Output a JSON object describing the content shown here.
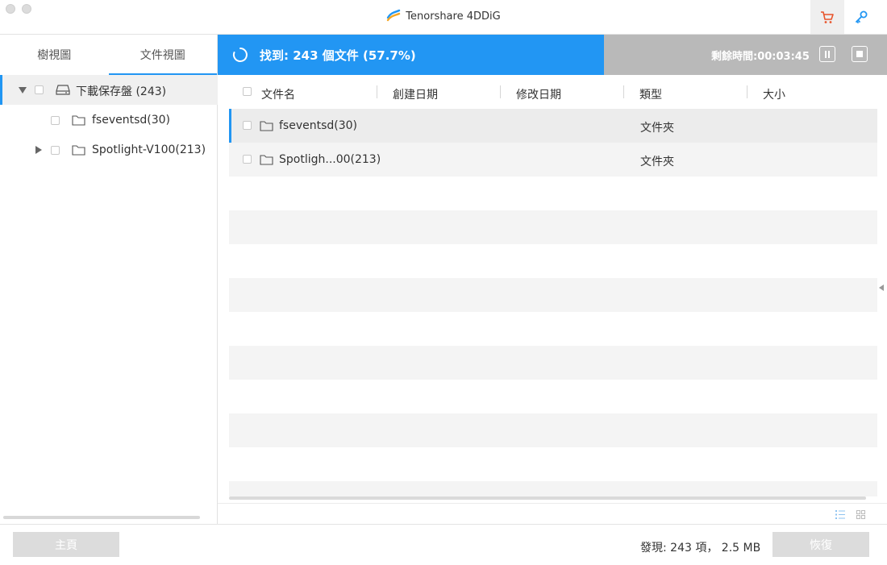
{
  "app": {
    "title": "Tenorshare 4DDiG"
  },
  "colors": {
    "accent": "#2296f3",
    "progress_track": "#b9b9b9",
    "cart": "#e8542b",
    "key": "#2196f3"
  },
  "left_panel": {
    "tabs": [
      {
        "label": "樹視圖"
      },
      {
        "label": "文件視圖"
      }
    ],
    "tree": [
      {
        "label": "下載保存盤 (243)",
        "icon": "drive-icon",
        "expanded": true
      },
      {
        "label": "fseventsd(30)",
        "icon": "folder-icon"
      },
      {
        "label": "Spotlight-V100(213)",
        "icon": "folder-icon",
        "expanded": false
      }
    ]
  },
  "scan": {
    "status_text": "找到: 243 個文件 (57.7%)",
    "progress": 0.577,
    "remaining_time": "剩餘時間:00:03:45"
  },
  "table": {
    "columns": [
      "文件名",
      "創建日期",
      "修改日期",
      "類型",
      "大小"
    ],
    "rows": [
      {
        "name": "fseventsd(30)",
        "created": "",
        "modified": "",
        "type": "文件夾",
        "size": ""
      },
      {
        "name": "Spotligh...00(213)",
        "created": "",
        "modified": "",
        "type": "文件夾",
        "size": ""
      }
    ]
  },
  "footer": {
    "home_button": "主頁",
    "found_summary": "發現: 243 項， 2.5 MB",
    "recover_button": "恢復"
  }
}
